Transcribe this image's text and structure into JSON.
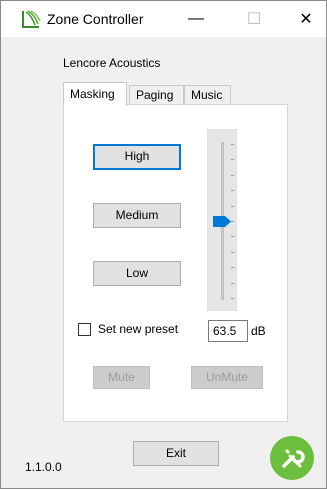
{
  "window": {
    "title": "Zone Controller",
    "min_glyph": "—",
    "max_glyph": "☐",
    "close_glyph": "✕",
    "icon": "app-logo-icon"
  },
  "company": "Lencore Acoustics",
  "tabs": [
    {
      "label": "Masking",
      "active": true
    },
    {
      "label": "Paging",
      "active": false
    },
    {
      "label": "Music",
      "active": false
    }
  ],
  "masking": {
    "buttons": {
      "high": "High",
      "medium": "Medium",
      "low": "Low"
    },
    "level_slider": {
      "value_fraction": 0.5
    },
    "preset_checkbox": {
      "label": "Set new preset",
      "checked": false
    },
    "db_value": "63.5",
    "db_unit": "dB",
    "mute_label": "Mute",
    "unmute_label": "UnMute"
  },
  "footer": {
    "version": "1.1.0.0",
    "exit_label": "Exit",
    "tools_icon": "wrench-screwdriver-icon"
  },
  "colors": {
    "accent": "#0078d7",
    "tools_bg": "#6cbf3c",
    "logo_green": "#4a9a2e"
  }
}
